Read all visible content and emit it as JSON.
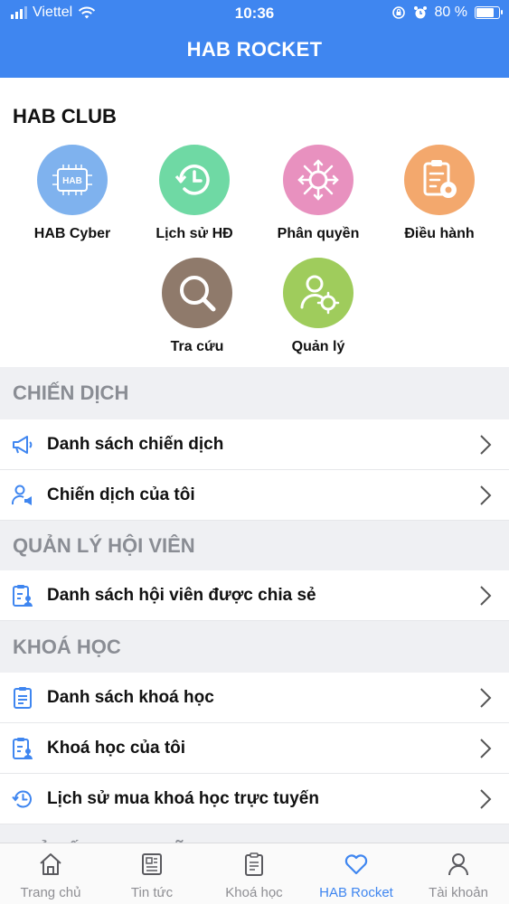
{
  "status": {
    "carrier": "Viettel",
    "time": "10:36",
    "battery_text": "80 %",
    "battery_level": 0.8
  },
  "header": {
    "title": "HAB ROCKET"
  },
  "club": {
    "title": "HAB CLUB",
    "tiles": [
      {
        "label": "HAB Cyber",
        "icon": "hab-chip-icon",
        "color": "#7fb2ee"
      },
      {
        "label": "Lịch sử HĐ",
        "icon": "history-icon",
        "color": "#6fd9a4"
      },
      {
        "label": "Phân quyền",
        "icon": "share-network-icon",
        "color": "#e891bf"
      },
      {
        "label": "Điều hành",
        "icon": "clipboard-gear-icon",
        "color": "#f3a86d"
      },
      {
        "label": "Tra cứu",
        "icon": "search-icon",
        "color": "#8f7a6b"
      },
      {
        "label": "Quản lý",
        "icon": "user-gear-icon",
        "color": "#9fcc5c"
      }
    ],
    "chip_text": "HAB"
  },
  "sections": [
    {
      "title": "CHIẾN DỊCH",
      "items": [
        "Danh sách chiến dịch",
        "Chiến dịch của tôi"
      ]
    },
    {
      "title": "QUẢN LÝ HỘI VIÊN",
      "items": [
        "Danh sách hội viên được chia sẻ"
      ]
    },
    {
      "title": "KHOÁ HỌC",
      "items": [
        "Danh sách khoá học",
        "Khoá học của tôi",
        "Lịch sử mua khoá học trực tuyến"
      ]
    },
    {
      "title": "CHỈ SỐ DINH DƯỠNG"
    }
  ],
  "tabs": [
    {
      "label": "Trang chủ",
      "icon": "home-icon"
    },
    {
      "label": "Tin tức",
      "icon": "news-icon"
    },
    {
      "label": "Khoá học",
      "icon": "clipboard-icon"
    },
    {
      "label": "HAB Rocket",
      "icon": "heart-icon",
      "active": true
    },
    {
      "label": "Tài khoản",
      "icon": "user-icon"
    }
  ],
  "colors": {
    "primary": "#3f86f0",
    "row_icon": "#3f86f0",
    "section_bg": "#eff0f3"
  }
}
